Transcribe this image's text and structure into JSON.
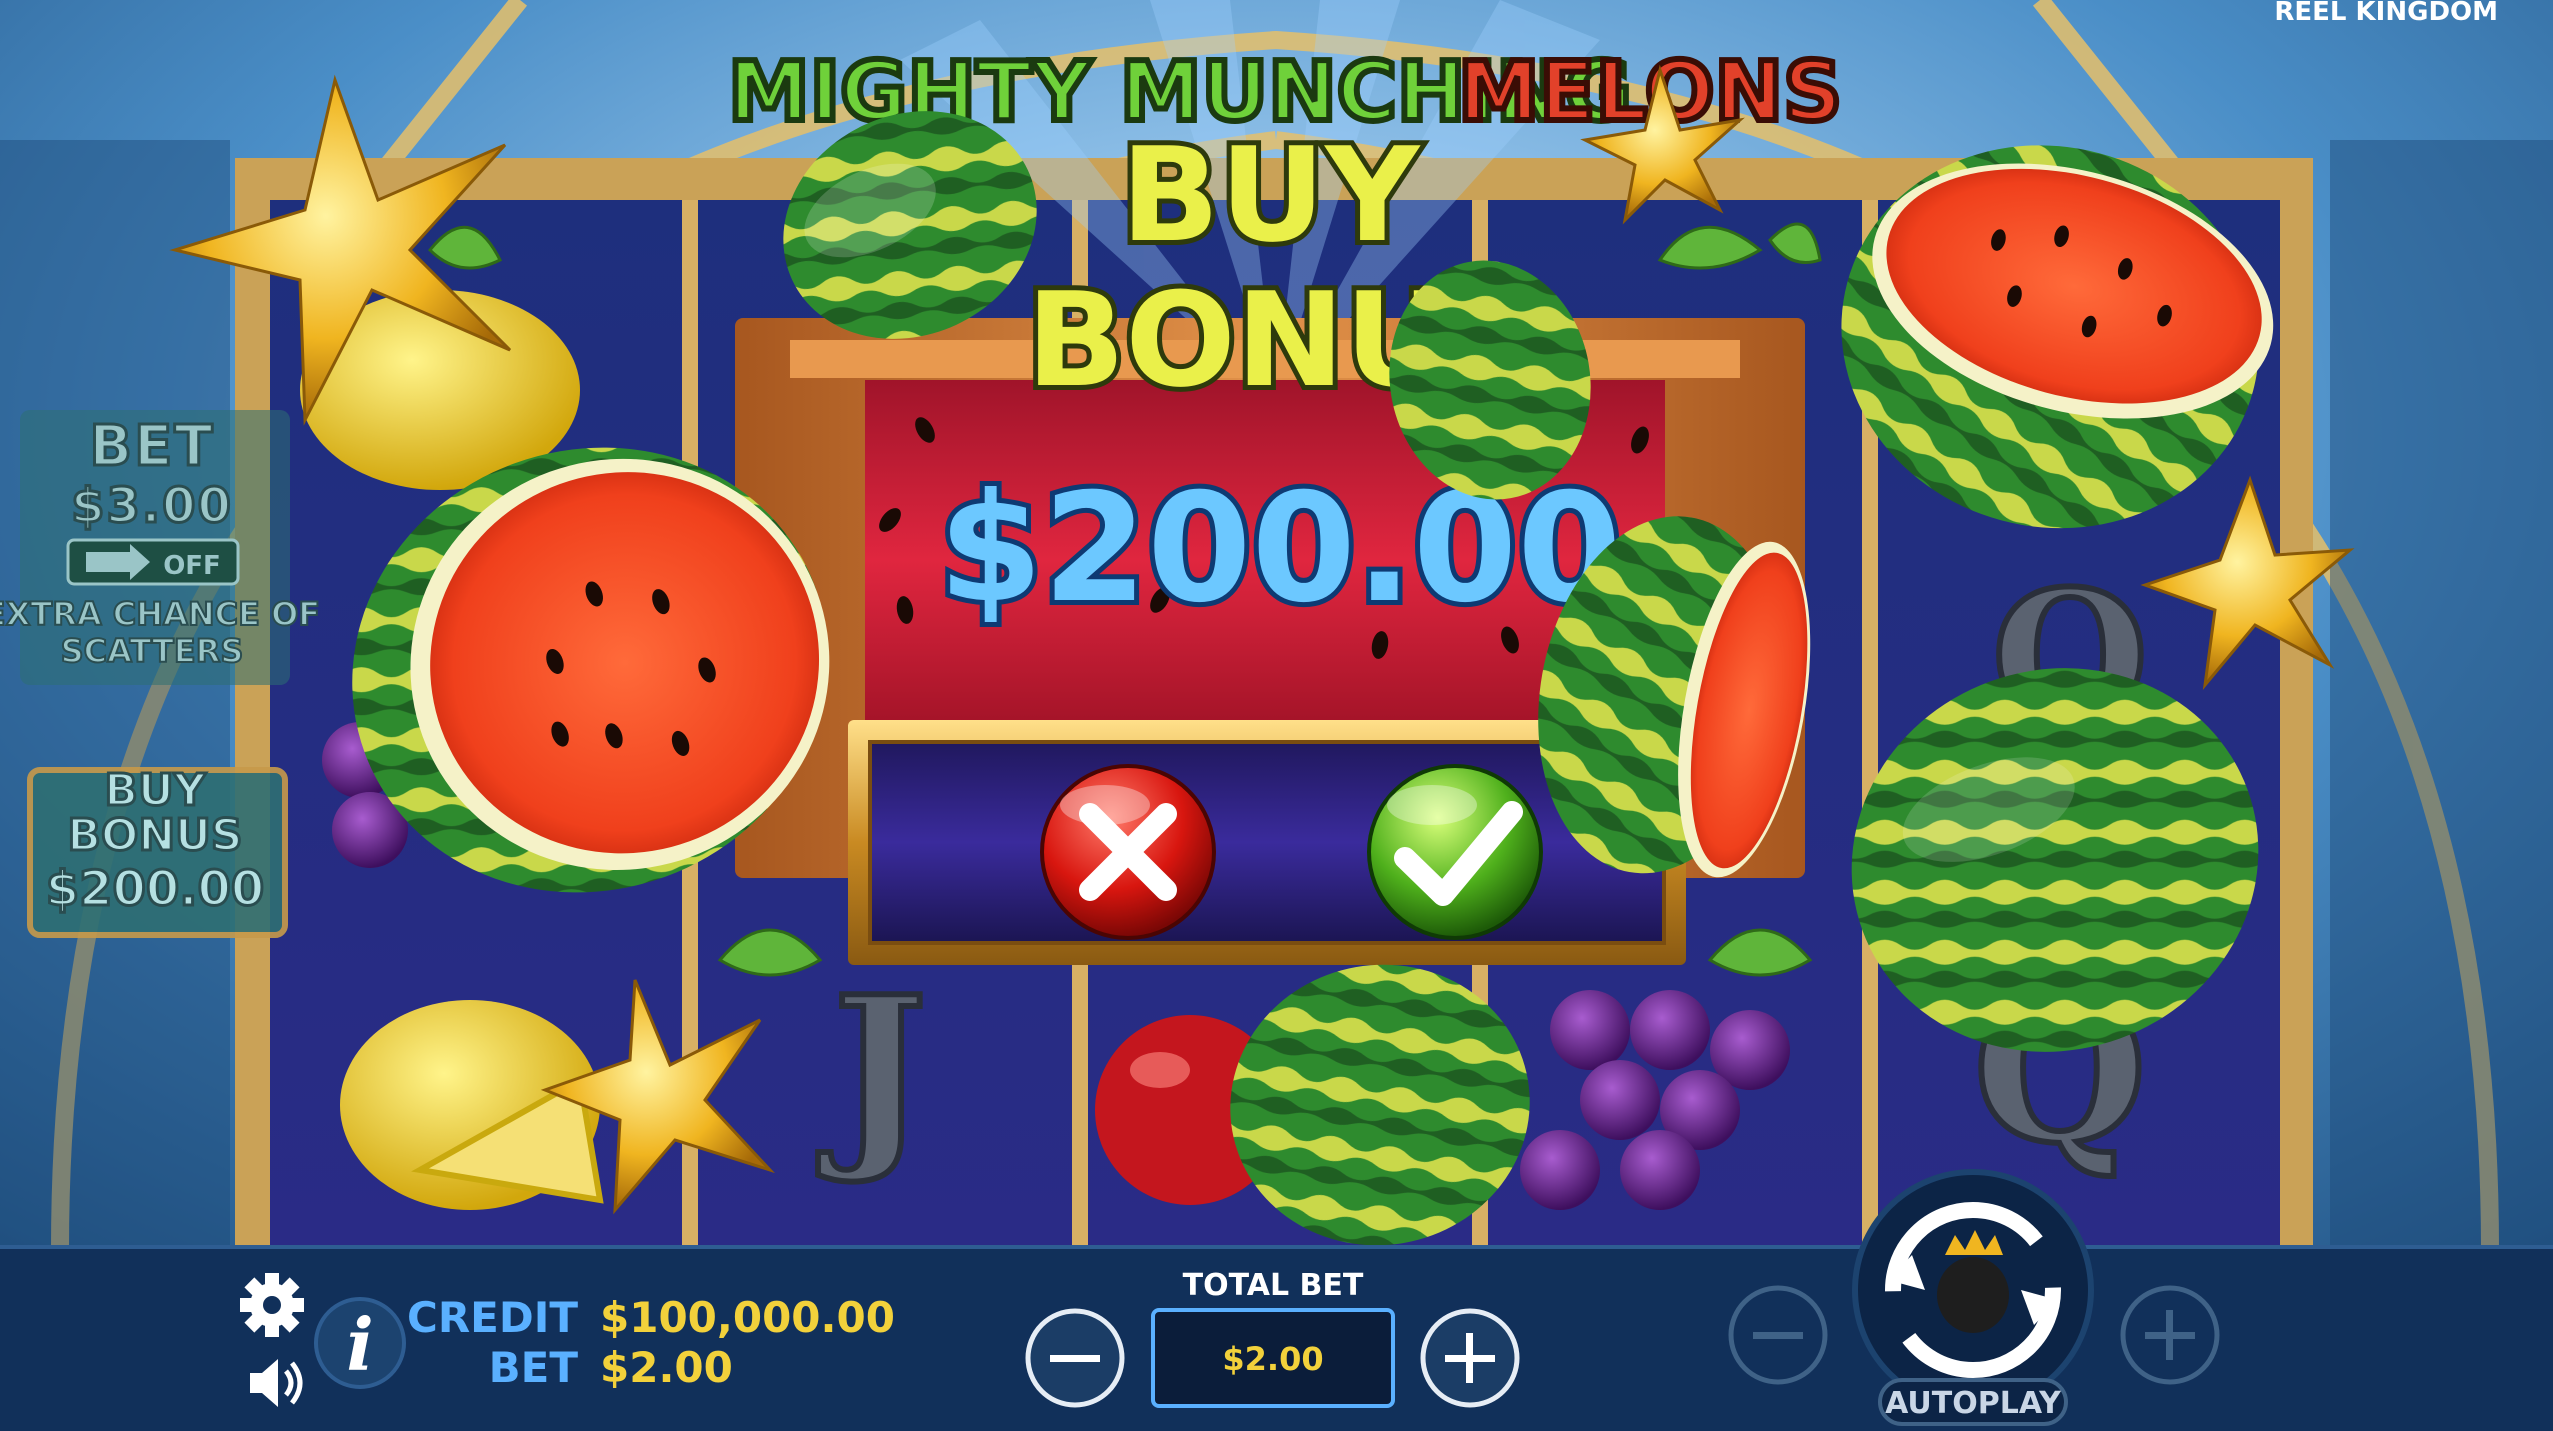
{
  "game": {
    "title_part1": "MIGHTY MUNCHING",
    "title_part2": "MELONS",
    "provider": "REEL KINGDOM"
  },
  "side_panel": {
    "bet_label": "BET",
    "bet_value": "$3.00",
    "toggle_state": "OFF",
    "extra_chance_line1": "EXTRA CHANCE OF",
    "extra_chance_line2": "SCATTERS",
    "buy_line1": "BUY",
    "buy_line2": "BONUS",
    "buy_price": "$200.00"
  },
  "dialog": {
    "heading_line1": "BUY",
    "heading_line2": "BONUS",
    "price": "$200.00",
    "cancel_icon": "cross-icon",
    "confirm_icon": "checkmark-icon"
  },
  "reels": {
    "visible_symbols": [
      "J",
      "Q",
      "Q"
    ]
  },
  "hud": {
    "credit_label": "CREDIT",
    "credit_value": "$100,000.00",
    "bet_label": "BET",
    "bet_value": "$2.00",
    "total_bet_label": "TOTAL BET",
    "total_bet_value": "$2.00",
    "autoplay_label": "AUTOPLAY",
    "icons": [
      "gear-icon",
      "info-icon",
      "speaker-icon",
      "minus-icon",
      "plus-icon",
      "spin-icon"
    ]
  },
  "colors": {
    "hud_accent": "#5ab0ff",
    "hud_value": "#f2d13b",
    "price_blue": "#6cc8ff",
    "heading_yellow": "#eaf04a",
    "dialog_red": "#d8213a",
    "frame_gold": "#d9a23b"
  }
}
